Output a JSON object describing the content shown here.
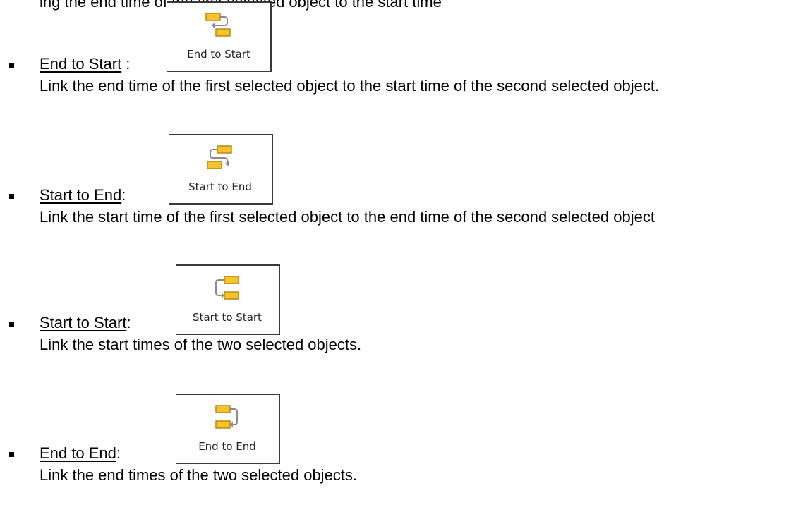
{
  "header": {
    "fragment": "ing the end time of the first selected object to the start time"
  },
  "items": [
    {
      "term": "End to Start",
      "separator": " :",
      "button": {
        "label": "End to Start",
        "icon": "link-end-to-start-icon"
      },
      "description": "Link the end time of the first selected object to the start time of the second selected object."
    },
    {
      "term": "Start to End",
      "separator": ":",
      "button": {
        "label": "Start to End",
        "icon": "link-start-to-end-icon"
      },
      "description": "Link the start time of the first selected object to the end time of the second selected object"
    },
    {
      "term": "Start to Start",
      "separator": ":",
      "button": {
        "label": "Start to Start",
        "icon": "link-start-to-start-icon"
      },
      "description": "Link the start times of the two selected objects."
    },
    {
      "term": "End to End",
      "separator": ":",
      "button": {
        "label": "End to End",
        "icon": "link-end-to-end-icon"
      },
      "description": "Link the end times of the two selected objects."
    }
  ],
  "colors": {
    "bar_fill": "#f7c22c",
    "bar_outline": "#b98a12",
    "connector": "#8a8a8a"
  }
}
